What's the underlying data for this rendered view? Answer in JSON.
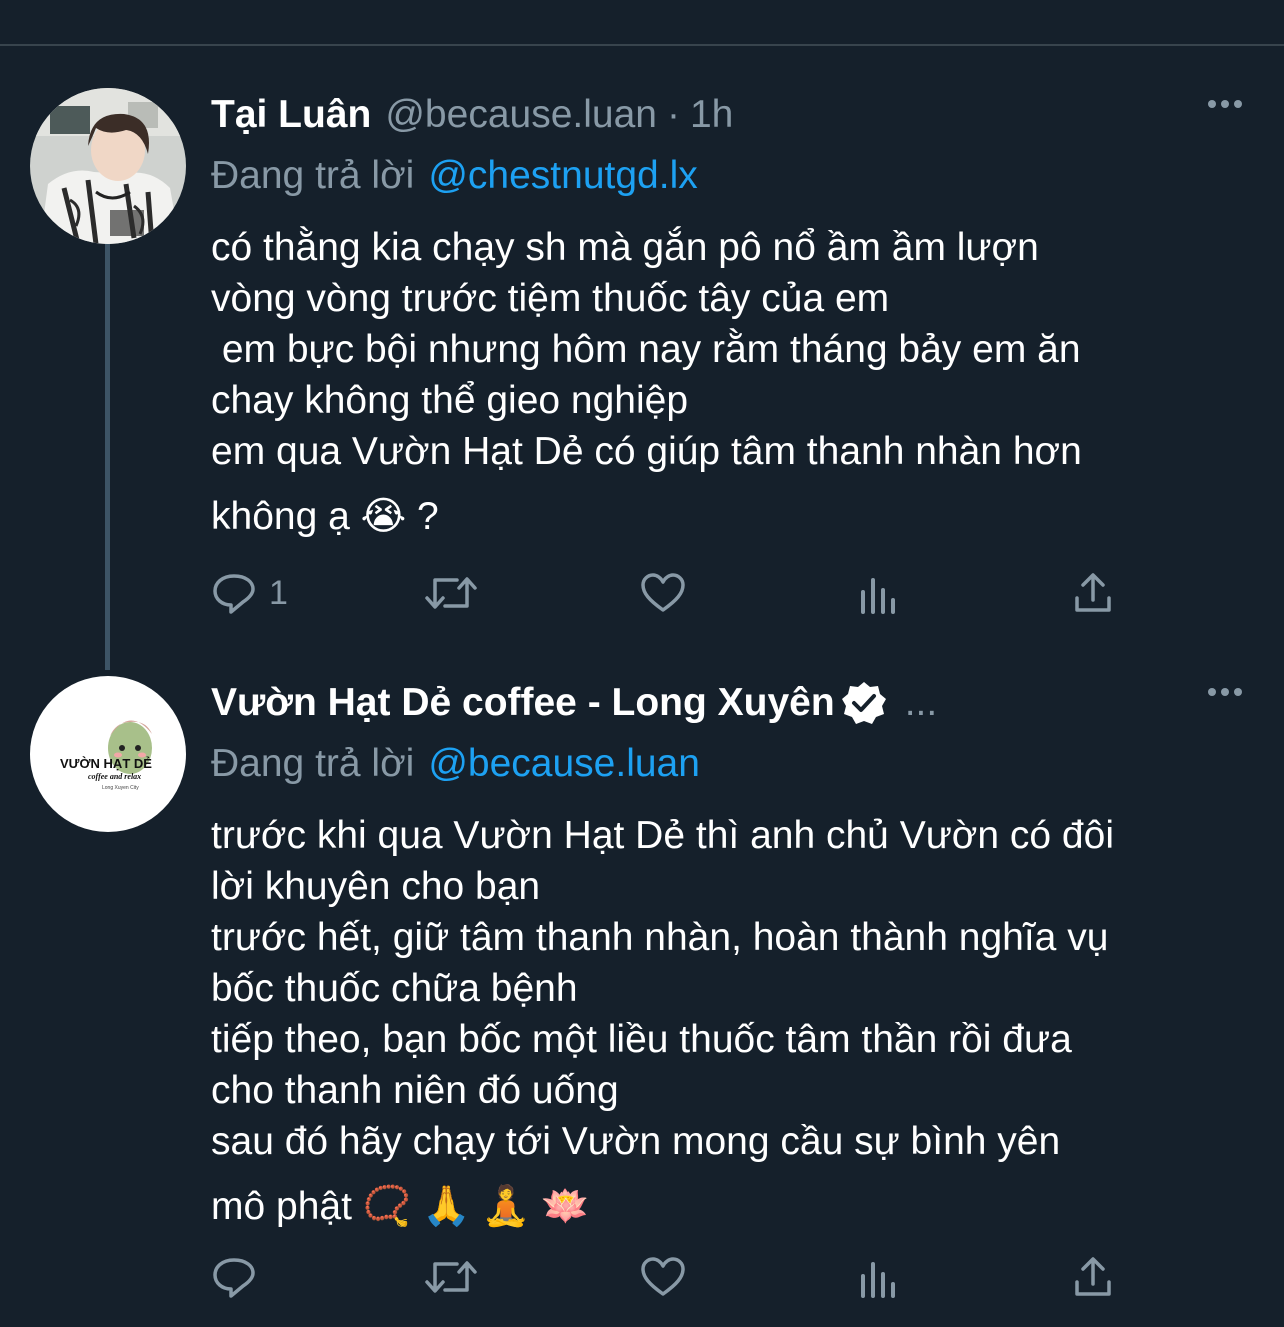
{
  "colors": {
    "background": "#15202b",
    "divider": "#38444d",
    "muted": "#8899a6",
    "link": "#1da1f2",
    "text": "#ffffff"
  },
  "tweets": [
    {
      "author_name": "Tại Luân",
      "handle": "@because.luan",
      "separator": "·",
      "time": "1h",
      "reply_label": "Đang trả lời",
      "reply_to": "@chestnutgd.lx",
      "body": [
        "có thằng kia chạy sh mà gắn pô nổ ầm ầm lượn",
        "vòng vòng trước tiệm thuốc tây của em",
        " em bực bội nhưng hôm nay rằm tháng bảy em ăn",
        "chay không thể gieo nghiệp",
        "em qua Vườn Hạt Dẻ có giúp tâm thanh nhàn hơn",
        "không ạ 😭 ?"
      ],
      "reply_count": "1"
    },
    {
      "author_name": "Vườn Hạt Dẻ coffee - Long Xuyên",
      "verified": true,
      "name_truncation": "...",
      "reply_label": "Đang trả lời",
      "reply_to": "@because.luan",
      "avatar_logo": {
        "title": "VƯỜN HẠT DẺ",
        "tagline": "coffee and relax",
        "city": "Long Xuyen City"
      },
      "body": [
        "trước khi qua Vườn Hạt Dẻ thì anh chủ Vườn có đôi",
        "lời khuyên cho bạn",
        "trước hết, giữ tâm thanh nhàn, hoàn thành nghĩa vụ",
        "bốc thuốc chữa bệnh",
        "tiếp theo, bạn bốc một liều thuốc tâm thần rồi đưa",
        "cho thanh niên đó uống",
        "sau đó hãy chạy tới Vườn mong cầu sự bình yên",
        "mô phật 📿 🙏 🧘 🪷"
      ],
      "reply_count": ""
    }
  ],
  "icons": [
    "reply-icon",
    "retweet-icon",
    "like-icon",
    "analytics-icon",
    "share-icon",
    "more-icon",
    "verified-badge-icon"
  ]
}
